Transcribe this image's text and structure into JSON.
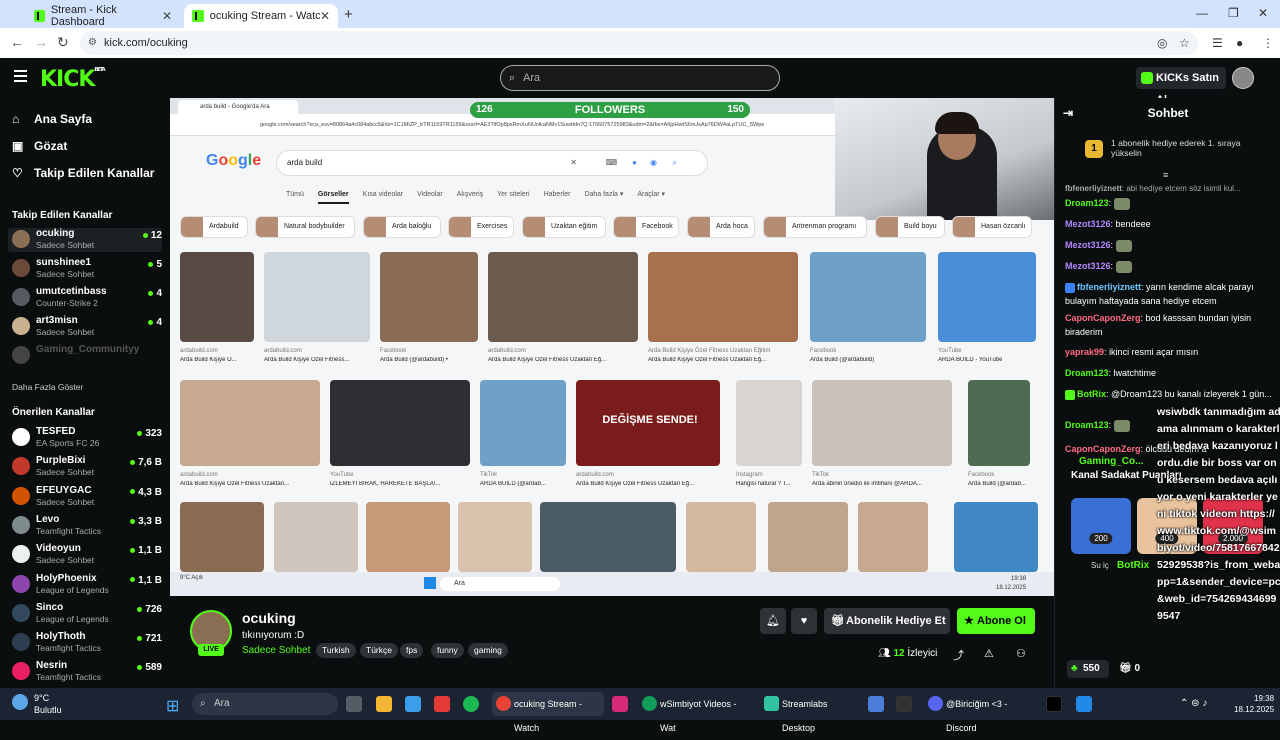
{
  "browser": {
    "tabs": [
      {
        "title": "Stream - Kick Dashboard"
      },
      {
        "title": "ocuking Stream - Watch Live on"
      }
    ],
    "url": "kick.com/ocuking"
  },
  "header": {
    "logo": "KICK",
    "logo_badge": "BETA",
    "search_placeholder": "Ara",
    "kicks_button": "KICKs Satın Al"
  },
  "sidebar": {
    "nav": [
      {
        "label": "Ana Sayfa",
        "icon": "home-icon"
      },
      {
        "label": "Gözat",
        "icon": "browse-icon"
      },
      {
        "label": "Takip Edilen Kanallar",
        "icon": "heart-icon"
      }
    ],
    "followed_title": "Takip Edilen Kanallar",
    "followed": [
      {
        "name": "ocuking",
        "category": "Sadece Sohbet",
        "viewers": "12",
        "avatar_color": "#8a6f54"
      },
      {
        "name": "sunshinee1",
        "category": "Sadece Sohbet",
        "viewers": "5",
        "avatar_color": "#6b4a3a"
      },
      {
        "name": "umutcetinbass",
        "category": "Counter-Strike 2",
        "viewers": "4",
        "avatar_color": "#555a60"
      },
      {
        "name": "art3misn",
        "category": "Sadece Sohbet",
        "viewers": "4",
        "avatar_color": "#c9b08f"
      },
      {
        "name": "Gaming_Communityy",
        "category": "",
        "viewers": "",
        "avatar_color": "#444"
      }
    ],
    "show_more": "Daha Fazla Göster",
    "recommended_title": "Önerilen Kanallar",
    "recommended": [
      {
        "name": "TESFED",
        "category": "EA Sports FC 26",
        "viewers": "323",
        "avatar_color": "#ffffff"
      },
      {
        "name": "PurpleBixi",
        "category": "Sadece Sohbet",
        "viewers": "7,6 B",
        "avatar_color": "#c0392b"
      },
      {
        "name": "EFEUYGAC",
        "category": "Sadece Sohbet",
        "viewers": "4,3 B",
        "avatar_color": "#d35400"
      },
      {
        "name": "Levo",
        "category": "Teamfight Tactics",
        "viewers": "3,3 B",
        "avatar_color": "#7f8c8d"
      },
      {
        "name": "Videoyun",
        "category": "Sadece Sohbet",
        "viewers": "1,1 B",
        "avatar_color": "#ecf0f1"
      },
      {
        "name": "HolyPhoenix",
        "category": "League of Legends",
        "viewers": "1,1 B",
        "avatar_color": "#8e44ad"
      },
      {
        "name": "Sinco",
        "category": "League of Legends",
        "viewers": "726",
        "avatar_color": "#34495e"
      },
      {
        "name": "HolyThoth",
        "category": "Teamfight Tactics",
        "viewers": "721",
        "avatar_color": "#2c3e50"
      },
      {
        "name": "Nesrin",
        "category": "Teamfight Tactics",
        "viewers": "589",
        "avatar_color": "#e91e63"
      }
    ]
  },
  "video": {
    "followers_min": "126",
    "followers_label": "FOLLOWERS",
    "followers_max": "150",
    "inner_tab": "arda build - Google'da Ara",
    "inner_url": "google.com/search?sca_esv=80864a4c084abcc5&rlz=1C1MIZP_trTR1159TR1159&sxsrf=AE3TifOp8pxRmXuNUnlkaNMv1Suwttdn7Q:1766075725983&udm=2&fbs=AIIjpHwtS6mJsAp76DW4aLpTUC_SWpe",
    "google_logo": "Google",
    "google_query": "arda build",
    "google_tabs": [
      "Tümü",
      "Görseller",
      "Kısa videolar",
      "Videolar",
      "Alışveriş",
      "Yer siteleri",
      "Haberler",
      "Daha fazla ▾",
      "Araçlar ▾"
    ],
    "chips": [
      "Ardabuild",
      "Natural bodybuilder",
      "Arda baloğlu",
      "Exercises",
      "Uzaktan eğitim",
      "Facebook",
      "Arda hoca",
      "Antrenman programı",
      "Build boyu",
      "Hasan özcanlı"
    ],
    "captions": [
      "Arda Build Kişiye Ö...",
      "Arda Build Kişiye Özel Fitness...",
      "Arda Build (@ardabuild) •",
      "Arda Build Kişiye Özel Fitness Uzaktan Eğ...",
      "Arda Build Kişiye Özel Fitness Uzaktan Eğ...",
      "Arda Build (@ardabuild)",
      "ARDA BUILD - YouTube",
      "Arda Build Kişiye Özel Fitness Uzaktan...",
      "İZLEMEYİ BIRAK, HAREKETE BAŞLA!...",
      "ARDA BUILD (@ardab...",
      "Arda Build Kişiye Özel Fitness Uzaktan Eğ...",
      "Hangisi natural ? T...",
      "Arda abinin onedio ile imtihanı @ARDA...",
      "Arda Build (@ardab..."
    ],
    "sources": [
      "ardabuild.com",
      "ardabuild.com",
      "Facebook",
      "ardabuild.com",
      "Arda Build Kişiye Özel Fitness Uzaktan Eğitim",
      "Facebook",
      "YouTube",
      "ardabuild.com",
      "YouTube",
      "TikTok",
      "ardabuild.com",
      "Instagram",
      "TikTok",
      "Facebook"
    ],
    "banner_text": "DEĞİŞME SENDE!",
    "taskbar_search": "Ara",
    "weather": "9°C Açık",
    "clock_time": "19:38",
    "clock_date": "18.12.2025"
  },
  "channel": {
    "name": "ocuking",
    "live_badge": "LIVE",
    "title": "tıkınıyorum :D",
    "category": "Sadece Sohbet",
    "tags": [
      "Turkish",
      "Türkçe",
      "fps",
      "funny",
      "gaming"
    ],
    "gift_button": "Abonelik Hediye Et",
    "subscribe_button": "Abone Ol",
    "viewers": "12",
    "viewers_label": "İzleyici"
  },
  "chat": {
    "title": "Sohbet",
    "pinned_badge": "1",
    "pinned_text": "1 abonelik hediye ederek 1. sıraya yükselin",
    "messages": [
      {
        "user": "fbfenerliyiznett",
        "text": "abi hediye etcem söz isimli kul...",
        "color": "#aaaaaa",
        "reply": true
      },
      {
        "user": "Droam123",
        "text": "",
        "color": "#53fc18",
        "emote": true
      },
      {
        "user": "Mezot3126",
        "text": "bendeee",
        "color": "#b388ff"
      },
      {
        "user": "Mezot3126",
        "text": "",
        "color": "#b388ff",
        "emote": true
      },
      {
        "user": "Mezot3126",
        "text": "",
        "color": "#b388ff",
        "emote": true
      },
      {
        "user": "fbfenerliyiznett",
        "text": "yarın kendime alcak parayı bulayım haftayada sana hediye etcem",
        "color": "#6ec6ff",
        "badge": true
      },
      {
        "user": "CaponCaponZerg",
        "text": "bod kasssan bundan iyisin biraderim",
        "color": "#ff6b81"
      },
      {
        "user": "yaprak99",
        "text": "ikinci resmi açar mısın",
        "color": "#ff6b81"
      },
      {
        "user": "Droam123",
        "text": "lwatchtime",
        "color": "#53fc18"
      },
      {
        "user": "BotRix",
        "text": "@Droam123 bu kanalı izleyerek 1 gün...",
        "color": "#53fc18",
        "badge": true
      },
      {
        "user": "Droam123",
        "text": "",
        "color": "#53fc18",
        "emote": true
      },
      {
        "user": "CaponCaponZerg",
        "text": "ölcüdü dedim a",
        "color": "#ff6b81"
      }
    ],
    "overlay_gc": "Gaming_Co...",
    "overlay_title": "Kanal Sadakat Puanları",
    "loyalty": [
      {
        "value": "200",
        "color": "#3a6fd8"
      },
      {
        "value": "400",
        "color": "#e8c39e"
      },
      {
        "value": "2.000",
        "color": "#e0334b"
      }
    ],
    "loyalty_caption": "Su iç",
    "botrix_overlay": "BotRix",
    "overlay_text": "wsiwbdk tanımadığım adama alınmam o karakterleri bedava kazanıyoruz lordu.die bir boss var onu kesersem bedava açılıyor o yeni karakterler yeni tiktok videom https://www.tiktok.com/@wsimbiyot/video/7581766784252929538?is_from_webapp=1&sender_device=pc&web_id=7542694346999547",
    "points": "550",
    "gifts": "0"
  },
  "taskbar": {
    "weather_temp": "9°C",
    "weather_desc": "Bulutlu",
    "search": "Ara",
    "apps": [
      {
        "label": "ocuking Stream - Watch",
        "color": "#ea4335"
      },
      {
        "label": "wSimbiyot Videos - Wat",
        "color": "#0f9d58"
      },
      {
        "label": "Streamlabs Desktop",
        "color": "#31c3a2"
      },
      {
        "label": "@Biriciğim <3 - Discord",
        "color": "#5865f2"
      }
    ],
    "time": "19:38",
    "date": "18.12.2025"
  }
}
